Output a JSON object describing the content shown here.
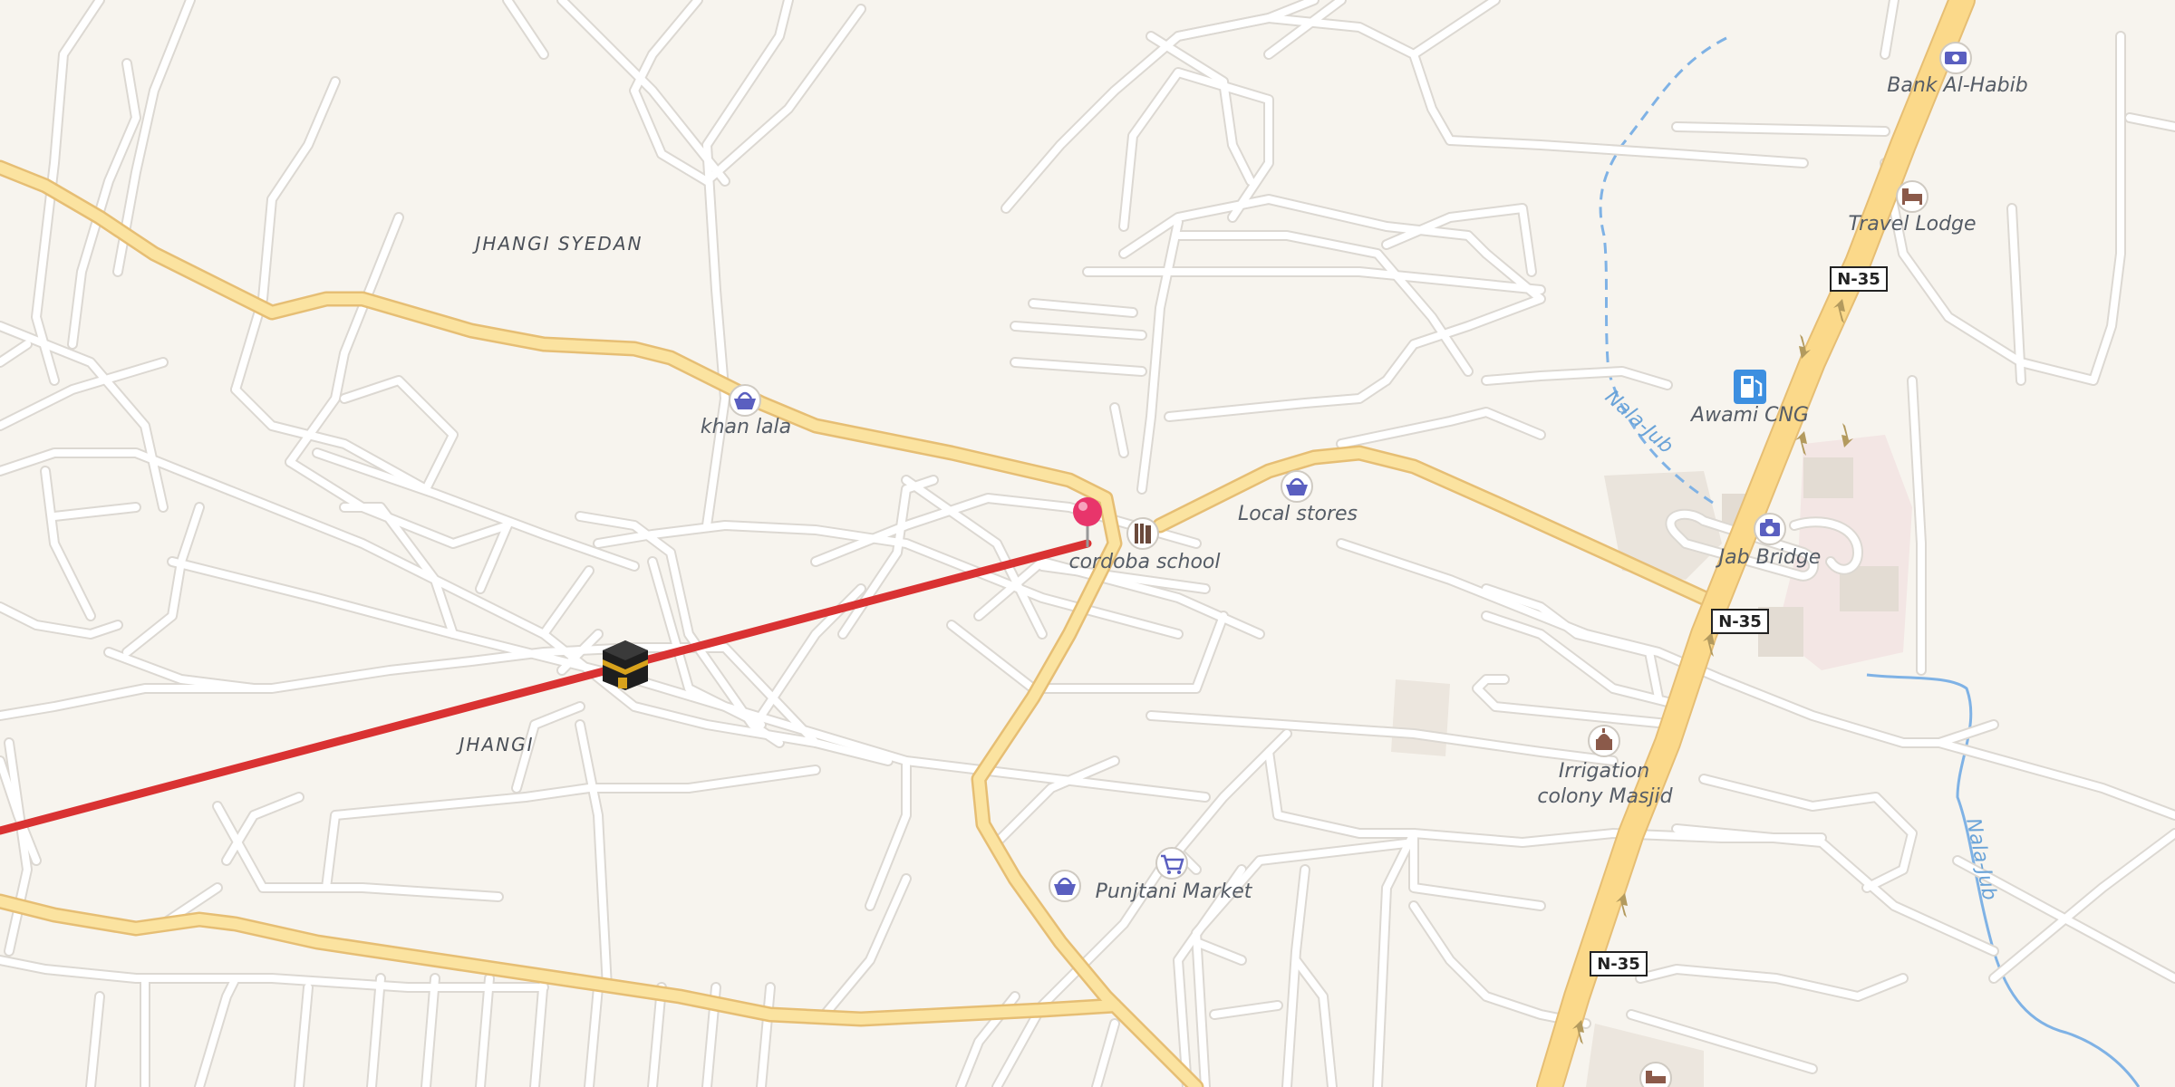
{
  "map": {
    "area_labels": {
      "jhangi_syedan": "JHANGI SYEDAN",
      "jhangi": "JHANGI"
    },
    "water_labels": {
      "nala_jub_1": "Nala-Jub",
      "nala_jub_2": "Nala-Jub"
    },
    "road_shields": {
      "n35_a": "N-35",
      "n35_b": "N-35",
      "n35_c": "N-35"
    },
    "pois": {
      "bank_al_habib": {
        "label": "Bank Al-Habib",
        "icon": "bank-icon"
      },
      "travel_lodge": {
        "label": "Travel Lodge",
        "icon": "bed-icon"
      },
      "awami_cng": {
        "label": "Awami CNG",
        "icon": "fuel-icon"
      },
      "jab_bridge": {
        "label": "Jab Bridge",
        "icon": "camera-icon"
      },
      "khan_lala": {
        "label": "khan lala",
        "icon": "shopping-basket-icon"
      },
      "local_stores": {
        "label": "Local stores",
        "icon": "shopping-basket-icon"
      },
      "cordoba_school": {
        "label": "cordoba school",
        "icon": "school-icon"
      },
      "irrigation_masjid": {
        "label_line1": "Irrigation",
        "label_line2": "colony Masjid",
        "icon": "mosque-icon"
      },
      "punjtani_market": {
        "label": "Punjtani Market",
        "icon": "shopping-cart-icon"
      },
      "unnamed_store": {
        "icon": "shopping-basket-icon"
      },
      "unnamed_lodge": {
        "icon": "bed-icon"
      }
    },
    "markers": {
      "pin": {
        "icon": "location-pin-icon",
        "color": "#e8356b"
      },
      "kaaba": {
        "icon": "kaaba-icon"
      }
    },
    "route_line_color": "#d93232",
    "colors": {
      "background": "#f7f4ee",
      "minor_road": "#ffffff",
      "minor_road_casing": "#dcd8d2",
      "major_road": "#fbe3a0",
      "major_road_casing": "#e6be74",
      "water": "#7fb2e5",
      "poi_icon": "#5a5fc0"
    }
  }
}
